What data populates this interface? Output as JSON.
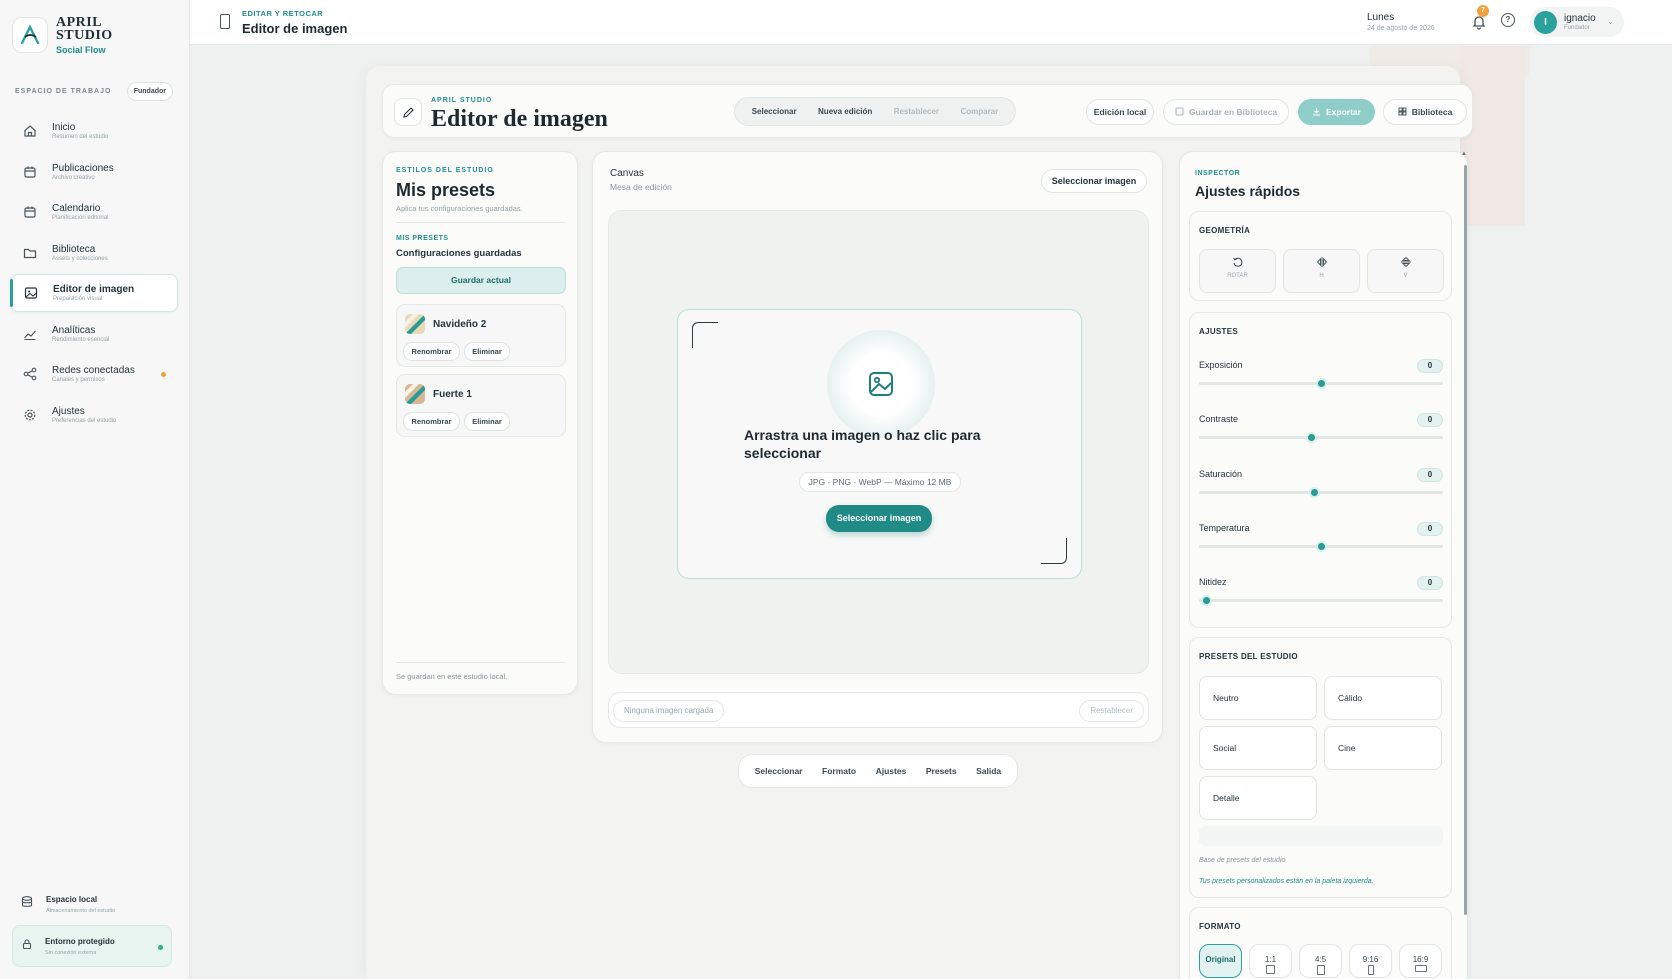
{
  "brand": {
    "line1": "APRIL",
    "line2": "STUDIO",
    "tagline": "Social Flow"
  },
  "workspace": {
    "label": "ESPACIO DE TRABAJO",
    "badge": "Fundador"
  },
  "nav": [
    {
      "label": "Inicio",
      "sub": "Resumen del estudio",
      "icon": "home-icon"
    },
    {
      "label": "Publicaciones",
      "sub": "Archivo creativo",
      "icon": "calendar-icon"
    },
    {
      "label": "Calendario",
      "sub": "Planificación editorial",
      "icon": "calendar-icon"
    },
    {
      "label": "Biblioteca",
      "sub": "Assets y colecciones",
      "icon": "folder-icon"
    },
    {
      "label": "Editor de imagen",
      "sub": "Preparación visual",
      "icon": "image-icon",
      "active": true
    },
    {
      "label": "Analíticas",
      "sub": "Rendimiento esencial",
      "icon": "chart-line-icon"
    },
    {
      "label": "Redes conectadas",
      "sub": "Canales y permisos",
      "icon": "share-icon"
    },
    {
      "label": "Ajustes",
      "sub": "Preferencias del estudio",
      "icon": "gear-icon"
    }
  ],
  "side_bottom": {
    "local_title": "Espacio local",
    "local_sub": "Almacenamiento del estudio",
    "safe_title": "Entorno protegido",
    "safe_sub": "Sin conexión externa"
  },
  "topbar": {
    "kicker": "EDITAR Y RETOCAR",
    "title": "Editor de imagen",
    "day": "Lunes",
    "date": "24 de agosto de 2026",
    "notifications": "7",
    "user_name": "ignacio",
    "user_role": "Fundador",
    "user_initial": "I"
  },
  "editor_header": {
    "kicker": "APRIL STUDIO",
    "title": "Editor de imagen",
    "tabs": [
      "Seleccionar",
      "Nueva edición",
      "Restablecer",
      "Comparar"
    ],
    "local_btn": "Edición local",
    "save_btn": "Guardar en Biblioteca",
    "export_btn": "Exportar",
    "library_btn": "Biblioteca"
  },
  "presets_panel": {
    "kicker": "ESTILOS DEL ESTUDIO",
    "title": "Mis presets",
    "subtitle": "Aplica tus configuraciones guardadas.",
    "my_kicker": "MIS PRESETS",
    "my_title": "Configuraciones guardadas",
    "save_current": "Guardar actual",
    "items": [
      {
        "name": "Navideño 2",
        "rename": "Renombrar",
        "delete": "Eliminar"
      },
      {
        "name": "Fuerte 1",
        "rename": "Renombrar",
        "delete": "Eliminar"
      }
    ],
    "footer": "Se guardan en este estudio local."
  },
  "canvas": {
    "title": "Canvas",
    "subtitle": "Mesa de edición",
    "select_btn": "Seleccionar imagen",
    "drop_title": "Arrastra una imagen o haz clic para seleccionar",
    "drop_formats": "JPG · PNG · WebP — Máximo 12 MB",
    "drop_btn": "Seleccionar imagen",
    "status": "Ninguna imagen cargada",
    "reset": "Restablecer"
  },
  "bottom_nav": [
    "Seleccionar",
    "Formato",
    "Ajustes",
    "Presets",
    "Salida"
  ],
  "inspector": {
    "kicker": "INSPECTOR",
    "title": "Ajustes rápidos",
    "geometry_title": "GEOMETRÍA",
    "geometry": [
      {
        "label": "ROTAR",
        "icon": "rotate-icon"
      },
      {
        "label": "H",
        "icon": "flip-horizontal-icon"
      },
      {
        "label": "V",
        "icon": "flip-vertical-icon"
      }
    ],
    "adjust_title": "AJUSTES",
    "sliders": [
      {
        "label": "Exposición",
        "value": "0",
        "pos": 0.5
      },
      {
        "label": "Contraste",
        "value": "0",
        "pos": 0.46
      },
      {
        "label": "Saturación",
        "value": "0",
        "pos": 0.47
      },
      {
        "label": "Temperatura",
        "value": "0",
        "pos": 0.5
      },
      {
        "label": "Nitidez",
        "value": "0",
        "pos": 0.03
      }
    ],
    "presets_title": "PRESETS DEL ESTUDIO",
    "presets": [
      "Neutro",
      "Cálido",
      "Social",
      "Cine",
      "Detalle"
    ],
    "presets_note1": "Base de presets del estudio",
    "presets_note2": "Tus presets personalizados están en la paleta izquierda.",
    "format_title": "FORMATO",
    "formats": [
      "Original",
      "1:1",
      "4:5",
      "9:16",
      "16:9"
    ]
  },
  "colors": {
    "accent": "#2aa19d",
    "accent_dark": "#1f8a86",
    "badge": "#f2a23b"
  }
}
